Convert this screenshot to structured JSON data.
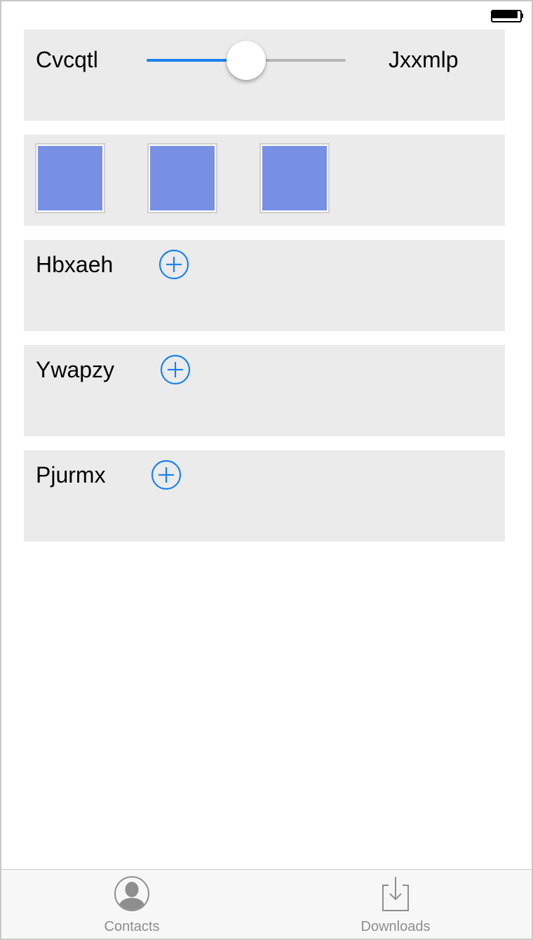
{
  "status_bar": {
    "battery_icon": "battery-full-icon"
  },
  "slider_card": {
    "min_label": "Cvcqtl",
    "max_label": "Jxxmlp",
    "value_fraction": 0.5,
    "accent_color": "#1a82f0"
  },
  "swatches": {
    "color": "#7890e4",
    "items": [
      {
        "icon": "color-swatch"
      },
      {
        "icon": "color-swatch"
      },
      {
        "icon": "color-swatch"
      }
    ]
  },
  "add_rows": [
    {
      "label": "Hbxaeh",
      "icon": "add-circle-icon"
    },
    {
      "label": "Ywapzy",
      "icon": "add-circle-icon"
    },
    {
      "label": "Pjurmx",
      "icon": "add-circle-icon"
    }
  ],
  "tab_bar": {
    "tabs": [
      {
        "label": "Contacts",
        "icon": "contacts-person-icon"
      },
      {
        "label": "Downloads",
        "icon": "downloads-tray-icon"
      }
    ]
  }
}
